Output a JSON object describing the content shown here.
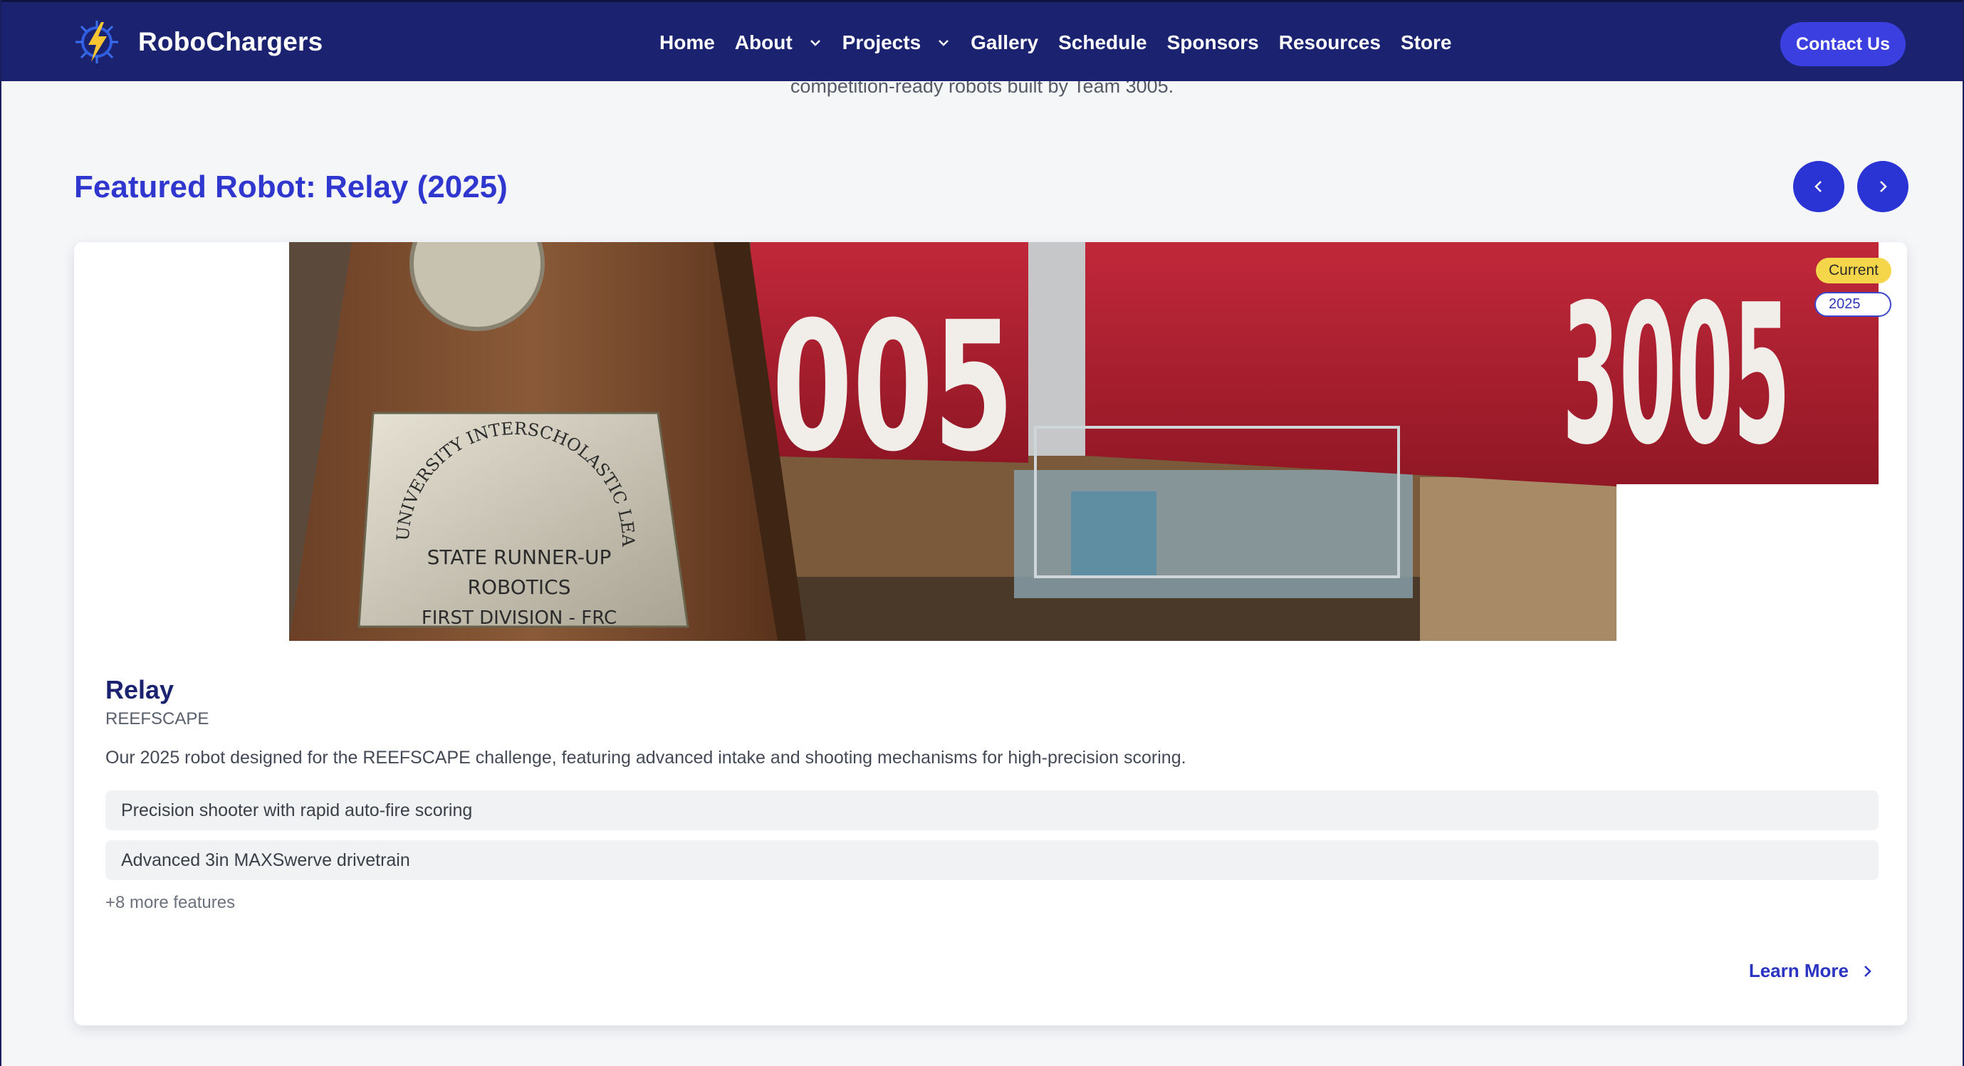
{
  "nav": {
    "brand": "RoboChargers",
    "items": [
      {
        "label": "Home",
        "dropdown": false
      },
      {
        "label": "About",
        "dropdown": true
      },
      {
        "label": "Projects",
        "dropdown": true
      },
      {
        "label": "Gallery",
        "dropdown": false
      },
      {
        "label": "Schedule",
        "dropdown": false
      },
      {
        "label": "Sponsors",
        "dropdown": false
      },
      {
        "label": "Resources",
        "dropdown": false
      },
      {
        "label": "Store",
        "dropdown": false
      }
    ],
    "contact_label": "Contact Us"
  },
  "intro": {
    "subtext": "competition-ready robots built by Team 3005."
  },
  "featured": {
    "title": "Featured Robot: Relay (2025)"
  },
  "card": {
    "badge_status": "Current",
    "badge_year": "2025",
    "plaque": {
      "arc_text": "UNIVERSITY INTERSCHOLASTIC LEAGUE",
      "line1": "STATE RUNNER-UP",
      "line2": "ROBOTICS",
      "line3": "FIRST DIVISION - FRC"
    },
    "bumper_number": "3005",
    "bumper_number_partial": "005",
    "name": "Relay",
    "game": "REEFSCAPE",
    "description": "Our 2025 robot designed for the REEFSCAPE challenge, featuring advanced intake and shooting mechanisms for high-precision scoring.",
    "features": [
      "Precision shooter with rapid auto-fire scoring",
      "Advanced 3in MAXSwerve drivetrain"
    ],
    "more_features": "+8 more features",
    "learn_more": "Learn More"
  },
  "colors": {
    "nav_bg": "#1b2371",
    "accent": "#3b3fe0",
    "title": "#2f37cf",
    "badge_current": "#f5d64a",
    "bumper_red": "#b0202e"
  }
}
